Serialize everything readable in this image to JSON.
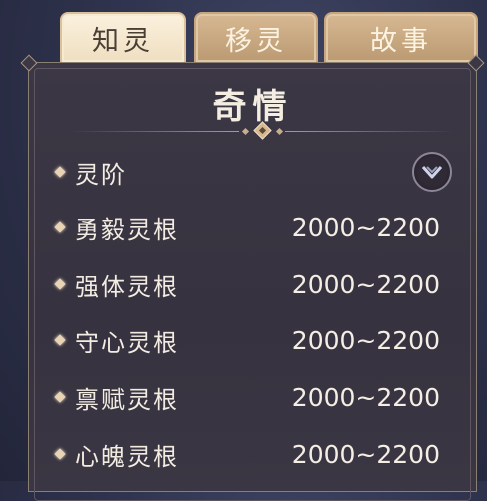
{
  "tabs": [
    {
      "label": "知灵",
      "active": true
    },
    {
      "label": "移灵",
      "active": false
    },
    {
      "label": "故事",
      "active": false
    }
  ],
  "panel": {
    "title": "奇情",
    "rows": [
      {
        "label": "灵阶",
        "value": ""
      },
      {
        "label": "勇毅灵根",
        "value": "2000~2200"
      },
      {
        "label": "强体灵根",
        "value": "2000~2200"
      },
      {
        "label": "守心灵根",
        "value": "2000~2200"
      },
      {
        "label": "禀赋灵根",
        "value": "2000~2200"
      },
      {
        "label": "心魄灵根",
        "value": "2000~2200"
      }
    ]
  },
  "colors": {
    "tab_active_bg": "#f5e8d0",
    "tab_inactive_bg": "#c9a87f",
    "panel_bg": "#38343f",
    "text": "#f3ece2"
  },
  "icons": {
    "row_bullet": "diamond-icon",
    "expand_toggle": "chevron-down-icon"
  }
}
